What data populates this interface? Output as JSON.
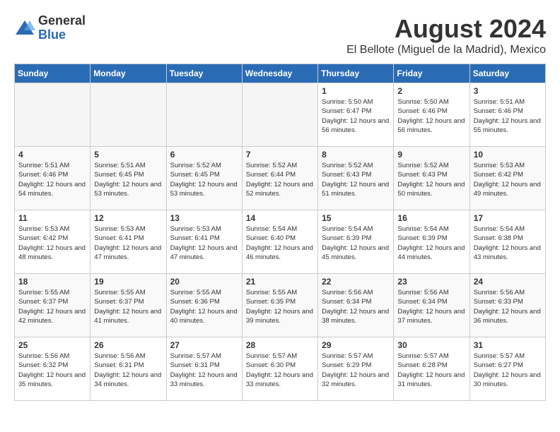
{
  "logo": {
    "general": "General",
    "blue": "Blue"
  },
  "title": "August 2024",
  "location": "El Bellote (Miguel de la Madrid), Mexico",
  "days_of_week": [
    "Sunday",
    "Monday",
    "Tuesday",
    "Wednesday",
    "Thursday",
    "Friday",
    "Saturday"
  ],
  "weeks": [
    [
      {
        "day": "",
        "empty": true
      },
      {
        "day": "",
        "empty": true
      },
      {
        "day": "",
        "empty": true
      },
      {
        "day": "",
        "empty": true
      },
      {
        "day": "1",
        "sunrise": "Sunrise: 5:50 AM",
        "sunset": "Sunset: 6:47 PM",
        "daylight": "Daylight: 12 hours and 56 minutes."
      },
      {
        "day": "2",
        "sunrise": "Sunrise: 5:50 AM",
        "sunset": "Sunset: 6:46 PM",
        "daylight": "Daylight: 12 hours and 56 minutes."
      },
      {
        "day": "3",
        "sunrise": "Sunrise: 5:51 AM",
        "sunset": "Sunset: 6:46 PM",
        "daylight": "Daylight: 12 hours and 55 minutes."
      }
    ],
    [
      {
        "day": "4",
        "sunrise": "Sunrise: 5:51 AM",
        "sunset": "Sunset: 6:46 PM",
        "daylight": "Daylight: 12 hours and 54 minutes."
      },
      {
        "day": "5",
        "sunrise": "Sunrise: 5:51 AM",
        "sunset": "Sunset: 6:45 PM",
        "daylight": "Daylight: 12 hours and 53 minutes."
      },
      {
        "day": "6",
        "sunrise": "Sunrise: 5:52 AM",
        "sunset": "Sunset: 6:45 PM",
        "daylight": "Daylight: 12 hours and 53 minutes."
      },
      {
        "day": "7",
        "sunrise": "Sunrise: 5:52 AM",
        "sunset": "Sunset: 6:44 PM",
        "daylight": "Daylight: 12 hours and 52 minutes."
      },
      {
        "day": "8",
        "sunrise": "Sunrise: 5:52 AM",
        "sunset": "Sunset: 6:43 PM",
        "daylight": "Daylight: 12 hours and 51 minutes."
      },
      {
        "day": "9",
        "sunrise": "Sunrise: 5:52 AM",
        "sunset": "Sunset: 6:43 PM",
        "daylight": "Daylight: 12 hours and 50 minutes."
      },
      {
        "day": "10",
        "sunrise": "Sunrise: 5:53 AM",
        "sunset": "Sunset: 6:42 PM",
        "daylight": "Daylight: 12 hours and 49 minutes."
      }
    ],
    [
      {
        "day": "11",
        "sunrise": "Sunrise: 5:53 AM",
        "sunset": "Sunset: 6:42 PM",
        "daylight": "Daylight: 12 hours and 48 minutes."
      },
      {
        "day": "12",
        "sunrise": "Sunrise: 5:53 AM",
        "sunset": "Sunset: 6:41 PM",
        "daylight": "Daylight: 12 hours and 47 minutes."
      },
      {
        "day": "13",
        "sunrise": "Sunrise: 5:53 AM",
        "sunset": "Sunset: 6:41 PM",
        "daylight": "Daylight: 12 hours and 47 minutes."
      },
      {
        "day": "14",
        "sunrise": "Sunrise: 5:54 AM",
        "sunset": "Sunset: 6:40 PM",
        "daylight": "Daylight: 12 hours and 46 minutes."
      },
      {
        "day": "15",
        "sunrise": "Sunrise: 5:54 AM",
        "sunset": "Sunset: 6:39 PM",
        "daylight": "Daylight: 12 hours and 45 minutes."
      },
      {
        "day": "16",
        "sunrise": "Sunrise: 5:54 AM",
        "sunset": "Sunset: 6:39 PM",
        "daylight": "Daylight: 12 hours and 44 minutes."
      },
      {
        "day": "17",
        "sunrise": "Sunrise: 5:54 AM",
        "sunset": "Sunset: 6:38 PM",
        "daylight": "Daylight: 12 hours and 43 minutes."
      }
    ],
    [
      {
        "day": "18",
        "sunrise": "Sunrise: 5:55 AM",
        "sunset": "Sunset: 6:37 PM",
        "daylight": "Daylight: 12 hours and 42 minutes."
      },
      {
        "day": "19",
        "sunrise": "Sunrise: 5:55 AM",
        "sunset": "Sunset: 6:37 PM",
        "daylight": "Daylight: 12 hours and 41 minutes."
      },
      {
        "day": "20",
        "sunrise": "Sunrise: 5:55 AM",
        "sunset": "Sunset: 6:36 PM",
        "daylight": "Daylight: 12 hours and 40 minutes."
      },
      {
        "day": "21",
        "sunrise": "Sunrise: 5:55 AM",
        "sunset": "Sunset: 6:35 PM",
        "daylight": "Daylight: 12 hours and 39 minutes."
      },
      {
        "day": "22",
        "sunrise": "Sunrise: 5:56 AM",
        "sunset": "Sunset: 6:34 PM",
        "daylight": "Daylight: 12 hours and 38 minutes."
      },
      {
        "day": "23",
        "sunrise": "Sunrise: 5:56 AM",
        "sunset": "Sunset: 6:34 PM",
        "daylight": "Daylight: 12 hours and 37 minutes."
      },
      {
        "day": "24",
        "sunrise": "Sunrise: 5:56 AM",
        "sunset": "Sunset: 6:33 PM",
        "daylight": "Daylight: 12 hours and 36 minutes."
      }
    ],
    [
      {
        "day": "25",
        "sunrise": "Sunrise: 5:56 AM",
        "sunset": "Sunset: 6:32 PM",
        "daylight": "Daylight: 12 hours and 35 minutes."
      },
      {
        "day": "26",
        "sunrise": "Sunrise: 5:56 AM",
        "sunset": "Sunset: 6:31 PM",
        "daylight": "Daylight: 12 hours and 34 minutes."
      },
      {
        "day": "27",
        "sunrise": "Sunrise: 5:57 AM",
        "sunset": "Sunset: 6:31 PM",
        "daylight": "Daylight: 12 hours and 33 minutes."
      },
      {
        "day": "28",
        "sunrise": "Sunrise: 5:57 AM",
        "sunset": "Sunset: 6:30 PM",
        "daylight": "Daylight: 12 hours and 33 minutes."
      },
      {
        "day": "29",
        "sunrise": "Sunrise: 5:57 AM",
        "sunset": "Sunset: 6:29 PM",
        "daylight": "Daylight: 12 hours and 32 minutes."
      },
      {
        "day": "30",
        "sunrise": "Sunrise: 5:57 AM",
        "sunset": "Sunset: 6:28 PM",
        "daylight": "Daylight: 12 hours and 31 minutes."
      },
      {
        "day": "31",
        "sunrise": "Sunrise: 5:57 AM",
        "sunset": "Sunset: 6:27 PM",
        "daylight": "Daylight: 12 hours and 30 minutes."
      }
    ]
  ]
}
